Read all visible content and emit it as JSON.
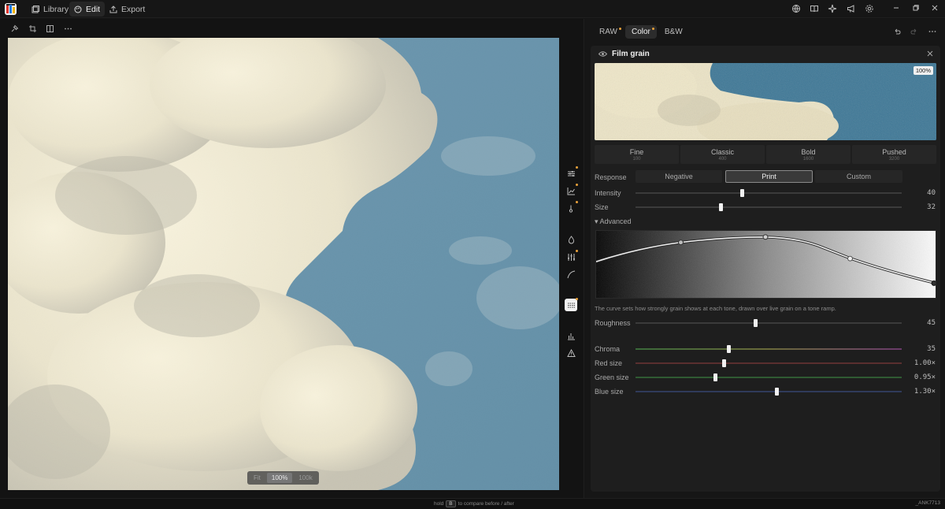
{
  "app": {
    "tabs": [
      {
        "label": "Library",
        "icon": "library-icon",
        "active": false
      },
      {
        "label": "Edit",
        "icon": "palette-icon",
        "active": true
      },
      {
        "label": "Export",
        "icon": "export-icon",
        "active": false
      }
    ],
    "top_icons": [
      "globe-icon",
      "book-icon",
      "sparkle-icon",
      "megaphone-icon",
      "gear-icon"
    ],
    "window_controls": [
      "minimize-icon",
      "restore-icon",
      "close-icon"
    ]
  },
  "canvas": {
    "tools": [
      "pin-icon",
      "crop-icon",
      "split-view-icon",
      "more-icon"
    ],
    "zoom": {
      "options": [
        "Fit",
        "100%",
        "100k"
      ],
      "selected": "100%"
    },
    "side_tools": [
      {
        "icon": "sliders-icon",
        "modified": true
      },
      {
        "icon": "chart-icon",
        "modified": true
      },
      {
        "icon": "thermometer-icon",
        "modified": true
      },
      {
        "icon": "drop-icon",
        "modified": false
      },
      {
        "icon": "mixer-icon",
        "modified": true
      },
      {
        "icon": "curve-icon",
        "modified": false
      },
      {
        "icon": "grain-icon",
        "modified": true,
        "active": true
      },
      {
        "icon": "histogram-icon",
        "modified": false
      },
      {
        "icon": "warning-icon",
        "modified": false
      }
    ]
  },
  "panel": {
    "modes": [
      {
        "label": "RAW",
        "modified": true,
        "active": false
      },
      {
        "label": "Color",
        "modified": true,
        "active": true
      },
      {
        "label": "B&W",
        "modified": false,
        "active": false
      }
    ],
    "header_icons": [
      "undo-icon",
      "redo-icon",
      "more-icon"
    ],
    "film_grain": {
      "title": "Film grain",
      "preview_zoom": "100%",
      "presets": [
        {
          "name": "Fine",
          "iso": "100"
        },
        {
          "name": "Classic",
          "iso": "400"
        },
        {
          "name": "Bold",
          "iso": "1600"
        },
        {
          "name": "Pushed",
          "iso": "3200"
        }
      ],
      "response": {
        "label": "Response",
        "options": [
          "Negative",
          "Print",
          "Custom"
        ],
        "selected": "Print"
      },
      "intensity": {
        "label": "Intensity",
        "value": "40",
        "fraction": 0.4
      },
      "size": {
        "label": "Size",
        "value": "32",
        "fraction": 0.32
      },
      "advanced_label": "▾ Advanced",
      "curve_hint": "The curve sets how strongly grain shows at each tone, drawn over live grain on a tone ramp.",
      "roughness": {
        "label": "Roughness",
        "value": "45",
        "fraction": 0.45
      },
      "chroma": {
        "label": "Chroma",
        "value": "35",
        "fraction": 0.35
      },
      "red_size": {
        "label": "Red size",
        "value": "1.00×",
        "fraction": 0.33
      },
      "green_size": {
        "label": "Green size",
        "value": "0.95×",
        "fraction": 0.3
      },
      "blue_size": {
        "label": "Blue size",
        "value": "1.30×",
        "fraction": 0.53
      }
    }
  },
  "status": {
    "hint_pre": "hold",
    "hint_key": "B",
    "hint_post": "to compare before / after",
    "filename": "_ANK7713"
  },
  "colors": {
    "accent_dot": "#e8a13a",
    "sky": "#3d7796",
    "cloud": "#efe7c8"
  }
}
